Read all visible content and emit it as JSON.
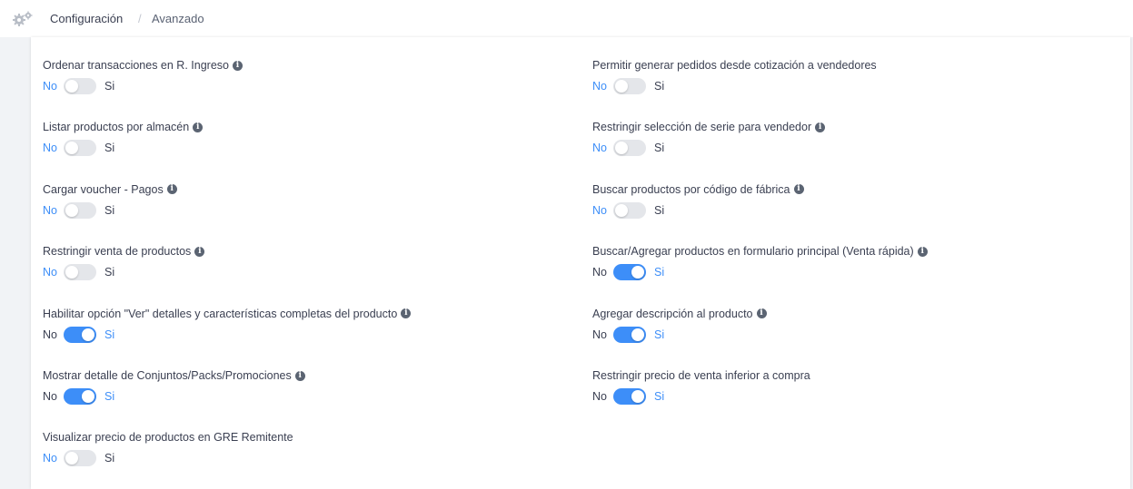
{
  "breadcrumb": {
    "icon": "gears-icon",
    "items": [
      "Configuración",
      "Avanzado"
    ],
    "separator": "/"
  },
  "colors": {
    "accent": "#3d8ef8",
    "switch_off": "#e4e6ea",
    "info_icon": "#5b6472"
  },
  "settings_left": [
    {
      "label": "Ordenar transacciones en R. Ingreso",
      "info": true,
      "on": false,
      "no": "No",
      "si": "Si"
    },
    {
      "label": "Listar productos por almacén",
      "info": true,
      "on": false,
      "no": "No",
      "si": "Si"
    },
    {
      "label": "Cargar voucher - Pagos",
      "info": true,
      "on": false,
      "no": "No",
      "si": "Si"
    },
    {
      "label": "Restringir venta de productos",
      "info": true,
      "on": false,
      "no": "No",
      "si": "Si"
    },
    {
      "label": "Habilitar opción \"Ver\" detalles y características completas del producto",
      "info": true,
      "on": true,
      "no": "No",
      "si": "Si"
    },
    {
      "label": "Mostrar detalle de Conjuntos/Packs/Promociones",
      "info": true,
      "on": true,
      "no": "No",
      "si": "Si"
    },
    {
      "label": "Visualizar precio de productos en GRE Remitente",
      "info": false,
      "on": false,
      "no": "No",
      "si": "Si"
    }
  ],
  "settings_right": [
    {
      "label": "Permitir generar pedidos desde cotización a vendedores",
      "info": false,
      "on": false,
      "no": "No",
      "si": "Si"
    },
    {
      "label": "Restringir selección de serie para vendedor",
      "info": true,
      "on": false,
      "no": "No",
      "si": "Si"
    },
    {
      "label": "Buscar productos por código de fábrica",
      "info": true,
      "on": false,
      "no": "No",
      "si": "Si"
    },
    {
      "label": "Buscar/Agregar productos en formulario principal (Venta rápida)",
      "info": true,
      "on": true,
      "no": "No",
      "si": "Si"
    },
    {
      "label": "Agregar descripción al producto",
      "info": true,
      "on": true,
      "no": "No",
      "si": "Si"
    },
    {
      "label": "Restringir precio de venta inferior a compra",
      "info": false,
      "on": true,
      "no": "No",
      "si": "Si"
    }
  ]
}
